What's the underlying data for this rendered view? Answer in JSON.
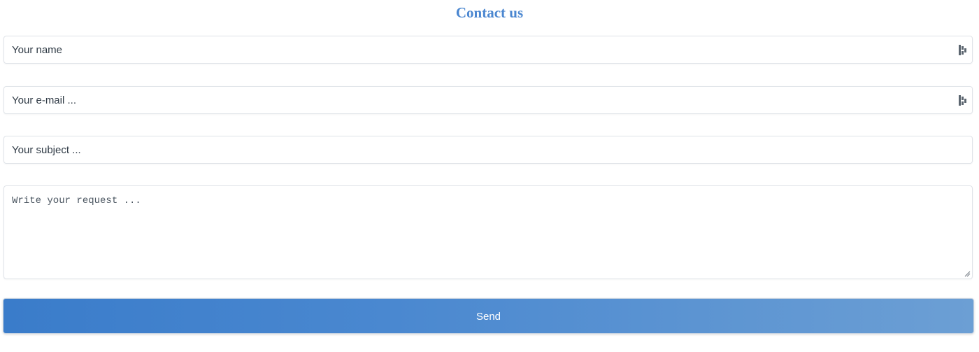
{
  "form": {
    "title": "Contact us",
    "name_placeholder": "Your name",
    "email_placeholder": "Your e-mail ...",
    "subject_placeholder": "Your subject ...",
    "message_placeholder": "Write your request ...",
    "send_label": "Send",
    "autofill_icon": "password-manager-key-icon",
    "accent_color": "#4a86d0",
    "button_gradient": [
      "#3a7cca",
      "#6c9fd4"
    ]
  }
}
